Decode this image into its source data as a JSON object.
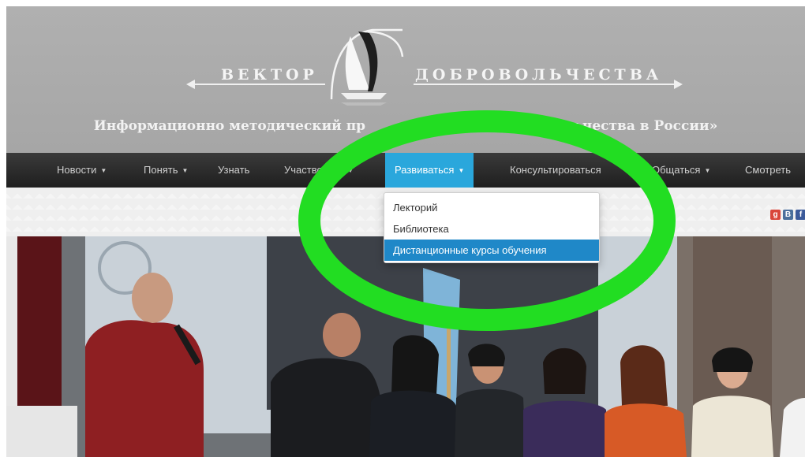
{
  "header": {
    "logo_left": "ВЕКТОР",
    "logo_right": "ДОБРОВОЛЬЧЕСТВА",
    "tagline": "Информационно методический пр",
    "tagline_end": "ольчества в России»"
  },
  "nav": {
    "items": [
      {
        "label": "Новости",
        "caret": true
      },
      {
        "label": "Понять",
        "caret": true
      },
      {
        "label": "Узнать",
        "caret": false
      },
      {
        "label": "Участвовать",
        "caret": true
      },
      {
        "label": "Развиваться",
        "caret": true,
        "active": true
      },
      {
        "label": "Консультироваться",
        "caret": false
      },
      {
        "label": "Общаться",
        "caret": true
      },
      {
        "label": "Смотреть",
        "caret": false
      }
    ],
    "caret_glyph": "▼"
  },
  "dropdown": {
    "items": [
      {
        "label": "Лекторий"
      },
      {
        "label": "Библиотека"
      },
      {
        "label": "Дистанционные курсы обучения",
        "active": true
      }
    ]
  },
  "social": {
    "icons": [
      {
        "name": "google-icon",
        "glyph": "g",
        "color": "#d9453a"
      },
      {
        "name": "vk-icon",
        "glyph": "B",
        "color": "#4a6f9c"
      },
      {
        "name": "facebook-icon",
        "glyph": "f",
        "color": "#3b5a9a"
      }
    ]
  },
  "colors": {
    "header_bg": "#aaaaaa",
    "nav_bg": "#2a2a2a",
    "nav_active": "#2aa7dc",
    "dropdown_active": "#1f88c8",
    "highlight": "#22dd22"
  }
}
